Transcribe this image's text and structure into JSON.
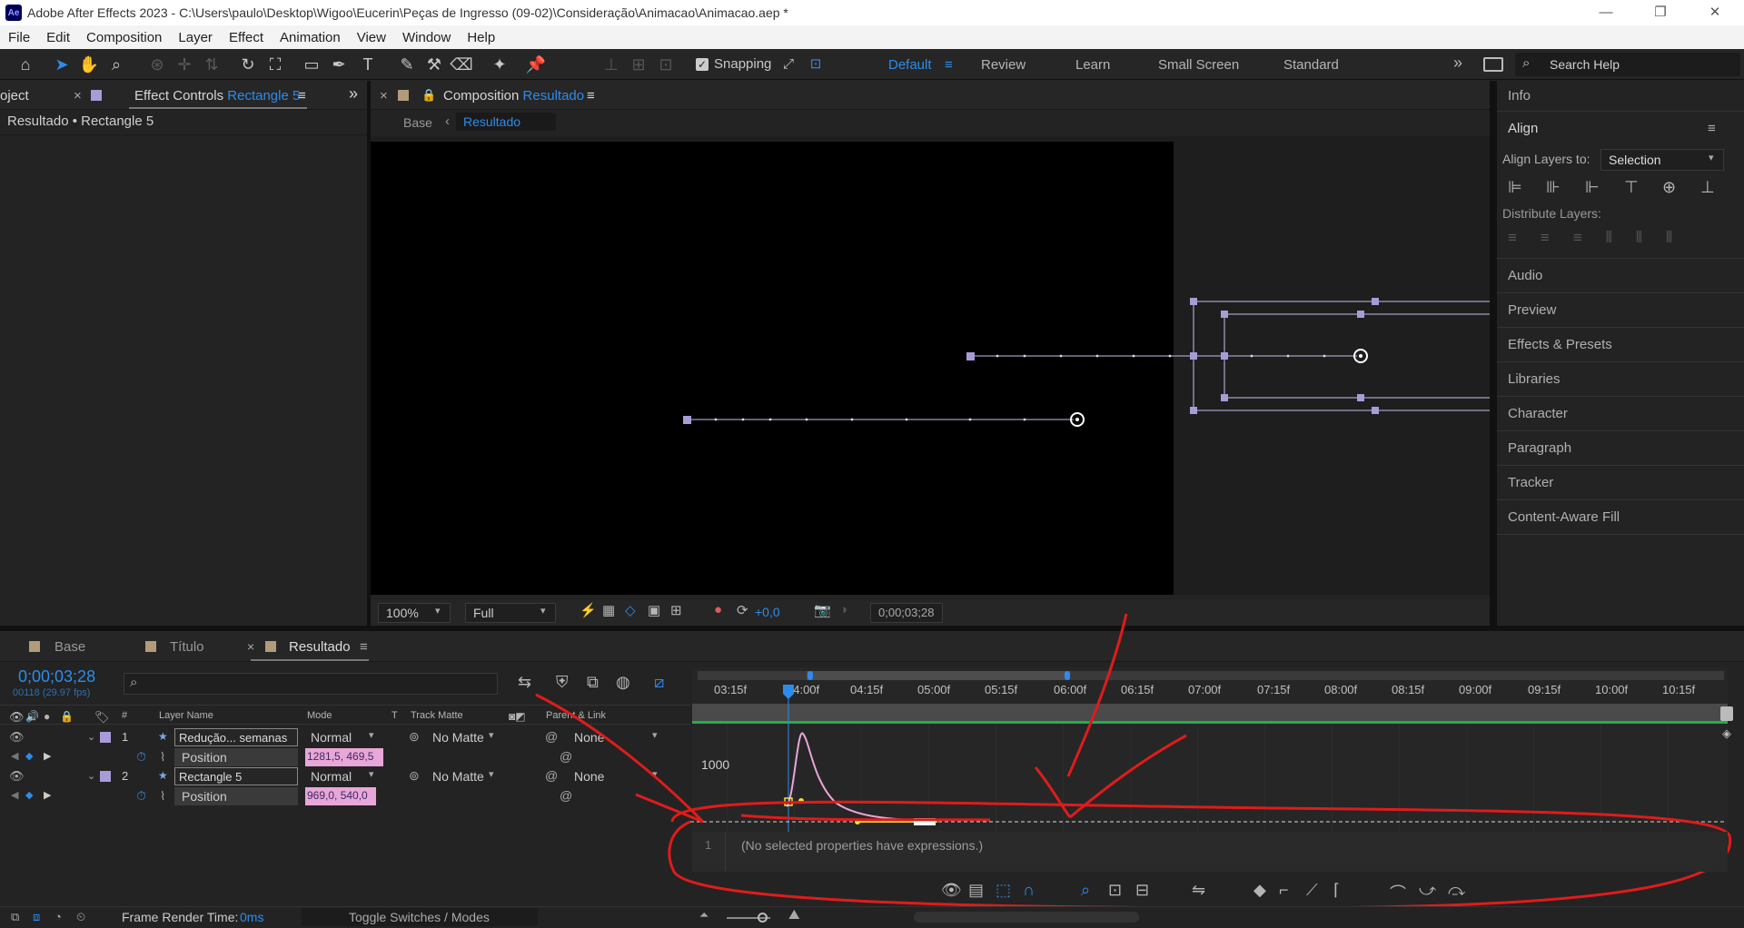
{
  "title_bar": {
    "app_title": "Adobe After Effects 2023 - C:\\Users\\paulo\\Desktop\\Wigoo\\Eucerin\\Peças de Ingresso (09-02)\\Consideração\\Animacao\\Animacao.aep *",
    "logo": "Ae",
    "minimize": "—",
    "restore": "❐",
    "close": "✕"
  },
  "menu": [
    "File",
    "Edit",
    "Composition",
    "Layer",
    "Effect",
    "Animation",
    "View",
    "Window",
    "Help"
  ],
  "toolbar": {
    "snapping_label": "Snapping",
    "workspaces": [
      "Default",
      "Review",
      "Learn",
      "Small Screen",
      "Standard"
    ],
    "more": "»",
    "search_placeholder": "Search Help"
  },
  "left_panel": {
    "project_tab": "oject",
    "close": "×",
    "effect_controls_label": "Effect Controls",
    "effect_controls_layer": "Rectangle 5",
    "breadcrumb": "Resultado • Rectangle 5",
    "expand": "»"
  },
  "composition": {
    "tab_label": "Composition",
    "tab_comp": "Resultado",
    "nav_base": "Base",
    "nav_arrow": "‹",
    "nav_current": "Resultado",
    "zoom": "100%",
    "resolution": "Full",
    "exposure": "+0,0",
    "timecode": "0;00;03;28"
  },
  "right_panel": {
    "info": "Info",
    "align": "Align",
    "align_layers_to": "Align Layers to:",
    "align_target": "Selection",
    "distribute_layers": "Distribute Layers:",
    "items": [
      "Audio",
      "Preview",
      "Effects & Presets",
      "Libraries",
      "Character",
      "Paragraph",
      "Tracker",
      "Content-Aware Fill"
    ]
  },
  "timeline": {
    "tabs": [
      "Base",
      "Título",
      "Resultado"
    ],
    "tab_close": "×",
    "timecode": "0;00;03;28",
    "fps": "00118 (29.97 fps)",
    "columns": {
      "hash": "#",
      "layer_name": "Layer Name",
      "mode": "Mode",
      "t": "T",
      "track_matte": "Track Matte",
      "parent": "Parent & Link"
    },
    "layers": [
      {
        "num": "1",
        "name": "Redução... semanas",
        "mode": "Normal",
        "matte": "No Matte",
        "parent": "None",
        "prop": "Position",
        "value": "1281,5, 469,5"
      },
      {
        "num": "2",
        "name": "Rectangle 5",
        "mode": "Normal",
        "matte": "No Matte",
        "parent": "None",
        "prop": "Position",
        "value": "969,0, 540,0"
      }
    ],
    "ruler": [
      "03:15f",
      "04:00f",
      "04:15f",
      "05:00f",
      "05:15f",
      "06:00f",
      "06:15f",
      "07:00f",
      "07:15f",
      "08:00f",
      "08:15f",
      "09:00f",
      "09:15f",
      "10:00f",
      "10:15f"
    ],
    "graph_value_label": "1000",
    "expression_line": "1",
    "expression_text": "(No selected properties have expressions.)",
    "frame_render_label": "Frame Render Time:",
    "frame_render_value": "0ms",
    "toggle_label": "Toggle Switches / Modes"
  },
  "colors": {
    "accent": "#2d8ceb",
    "annotation": "#e01b1b",
    "graph_curve": "#e9a6d8",
    "label_purple": "#a99bd8",
    "work_area": "#1fb04b"
  }
}
